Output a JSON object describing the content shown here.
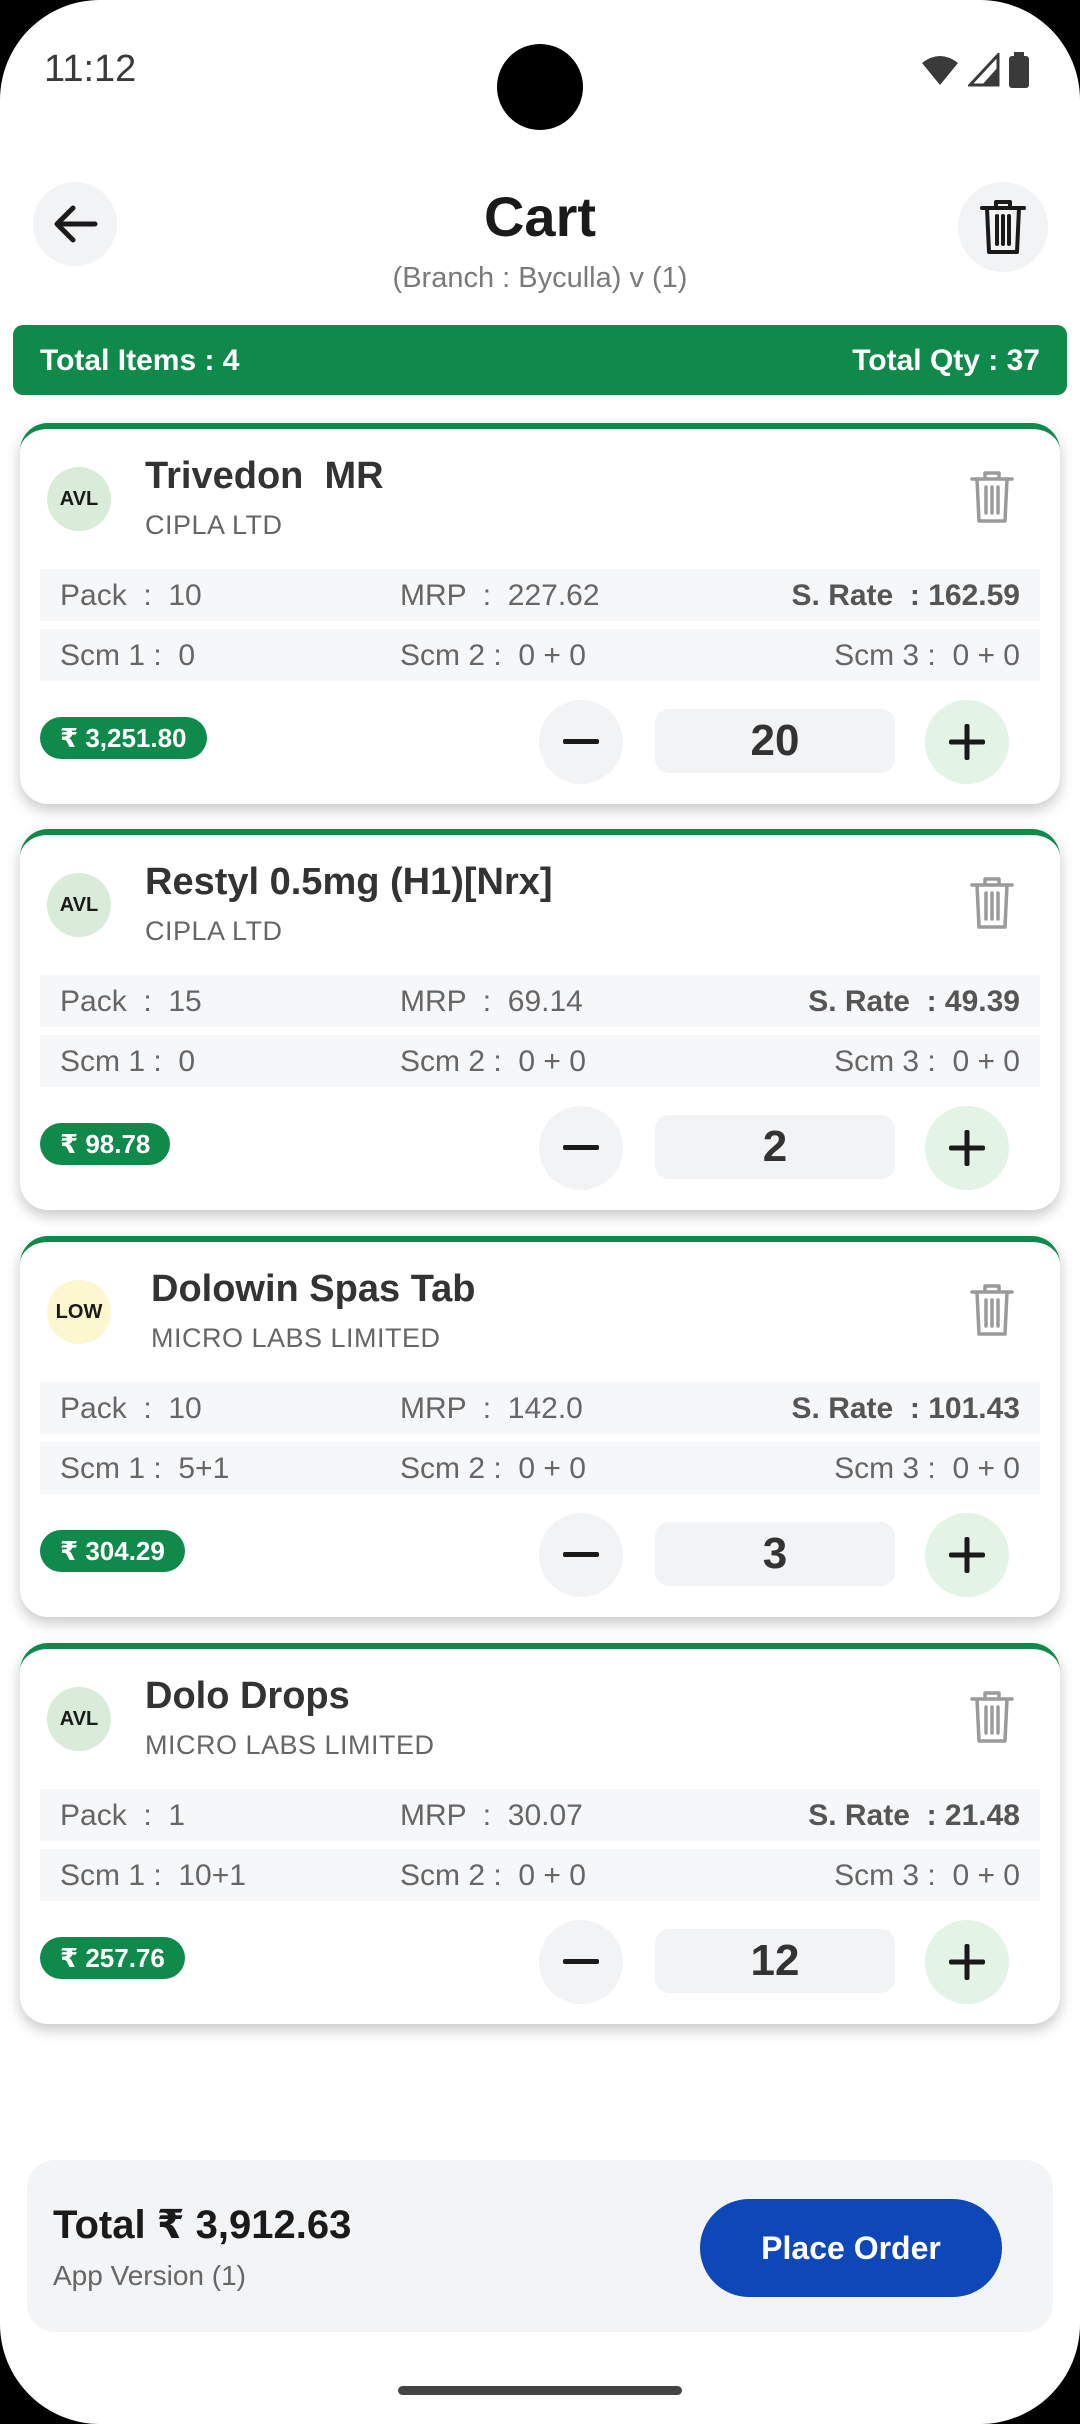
{
  "status_bar": {
    "time": "11:12"
  },
  "header": {
    "title": "Cart",
    "subtitle": "(Branch : Byculla)  v (1)"
  },
  "totals": {
    "items": "Total Items : 4",
    "qty": "Total Qty : 37"
  },
  "items": [
    {
      "badge": "AVL",
      "badge_type": "avl",
      "name": "Trivedon  MR",
      "manufacturer": "CIPLA LTD",
      "pack": "Pack  :  10",
      "mrp": "MRP  :  227.62",
      "srate_label": "S. Rate  :",
      "srate_value": "162.59",
      "scm1": "Scm 1 :  0",
      "scm2": "Scm 2 :  0 + 0",
      "scm3": "Scm 3 :  0 + 0",
      "amount": "₹ 3,251.80",
      "qty": "20"
    },
    {
      "badge": "AVL",
      "badge_type": "avl",
      "name": "Restyl 0.5mg (H1)[Nrx]",
      "manufacturer": "CIPLA LTD",
      "pack": "Pack  :  15",
      "mrp": "MRP  :  69.14",
      "srate_label": "S. Rate  :",
      "srate_value": "49.39",
      "scm1": "Scm 1 :  0",
      "scm2": "Scm 2 :  0 + 0",
      "scm3": "Scm 3 :  0 + 0",
      "amount": "₹ 98.78",
      "qty": "2"
    },
    {
      "badge": "LOW",
      "badge_type": "low",
      "name": "Dolowin Spas Tab",
      "manufacturer": "MICRO LABS LIMITED",
      "pack": "Pack  :  10",
      "mrp": "MRP  :  142.0",
      "srate_label": "S. Rate  :",
      "srate_value": "101.43",
      "scm1": "Scm 1 :  5+1",
      "scm2": "Scm 2 :  0 + 0",
      "scm3": "Scm 3 :  0 + 0",
      "amount": "₹ 304.29",
      "qty": "3"
    },
    {
      "badge": "AVL",
      "badge_type": "avl",
      "name": "Dolo Drops",
      "manufacturer": "MICRO LABS LIMITED",
      "pack": "Pack  :  1",
      "mrp": "MRP  :  30.07",
      "srate_label": "S. Rate  :",
      "srate_value": "21.48",
      "scm1": "Scm 1 :  10+1",
      "scm2": "Scm 2 :  0 + 0",
      "scm3": "Scm 3 :  0 + 0",
      "amount": "₹ 257.76",
      "qty": "12"
    }
  ],
  "footer": {
    "total": "Total ₹ 3,912.63",
    "app_version": "App Version (1)",
    "place_order": "Place Order"
  },
  "colors": {
    "primary_green": "#108a4b",
    "button_blue": "#0d47b8",
    "avl_badge": "#d8ecd9",
    "low_badge": "#fdf7cf"
  },
  "icons": {
    "back": "arrow-left-icon",
    "delete": "trash-icon",
    "minus": "minus-icon",
    "plus": "plus-icon"
  }
}
